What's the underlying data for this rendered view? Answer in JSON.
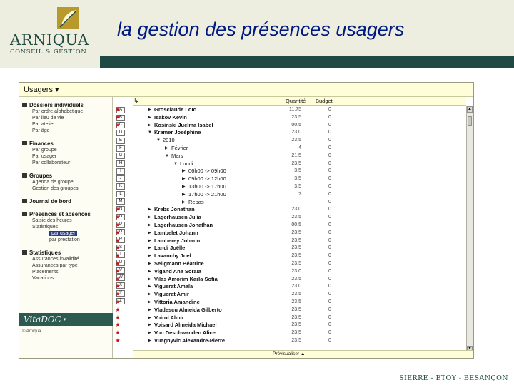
{
  "logo": {
    "name": "ARNIQUA",
    "subtitle": "CONSEIL & GESTION"
  },
  "slide": {
    "title": "la gestion des présences usagers",
    "footer": "SIERRE - ETOY - BESANÇON"
  },
  "colors": {
    "title": "#001a80",
    "brand": "#1f4a44",
    "header_bg": "#eeeee0",
    "star": "#c01010",
    "selection": "#2a3a8a"
  },
  "app": {
    "sidebar_title": "Usagers ▾",
    "sections": [
      {
        "label": "Dossiers individuels",
        "items": [
          "Par ordre alphabétique",
          "Par lieu de vie",
          "Par atelier",
          "Par âge"
        ]
      },
      {
        "label": "Finances",
        "items": [
          "Par groupe",
          "Par usager",
          "Par collaborateur"
        ]
      },
      {
        "label": "Groupes",
        "items": [
          "Agenda de groupe",
          "Gestion des groupes"
        ]
      },
      {
        "label": "Journal de bord",
        "items": []
      },
      {
        "label": "Présences et absences",
        "items": [
          "Saisie des heures",
          "Statistiques"
        ],
        "subitems": [
          "par usager",
          "par prestation"
        ]
      },
      {
        "label": "Statistiques",
        "items": [
          "Assurances invalidité",
          "Assurances par type",
          "Placements",
          "Vacations"
        ]
      }
    ],
    "vitadoc": {
      "label": "VitaDOC",
      "caret": "▾"
    },
    "copyright": "© Arniqua",
    "alphabet": [
      "A",
      "B",
      "C",
      "D",
      "E",
      "F",
      "G",
      "H",
      "I",
      "J",
      "K",
      "L",
      "M",
      "N",
      "O",
      "P",
      "Q",
      "R",
      "S",
      "T",
      "U",
      "V",
      "W",
      "X",
      "Y",
      "Z"
    ],
    "grid_header": {
      "icon": "↳",
      "quantite": "Quantité",
      "budget": "Budget"
    },
    "rows": [
      {
        "indent": 0,
        "arrow": "▶",
        "name": "Grosclaude Loïc",
        "qty": "11.75",
        "budget": "0"
      },
      {
        "indent": 0,
        "arrow": "▶",
        "name": "Isakov Kevin",
        "qty": "23.5",
        "budget": "0"
      },
      {
        "indent": 0,
        "arrow": "▶",
        "name": "Kosinski Juelma Isabel",
        "qty": "00.5",
        "budget": "0"
      },
      {
        "indent": 0,
        "arrow": "▼",
        "name": "Kramer Joséphine",
        "qty": "23.0",
        "budget": "0"
      },
      {
        "indent": 1,
        "arrow": "▼",
        "name": "2010",
        "qty": "23.5",
        "budget": "0"
      },
      {
        "indent": 2,
        "arrow": "▶",
        "name": "Février",
        "qty": "4",
        "budget": "0"
      },
      {
        "indent": 2,
        "arrow": "▼",
        "name": "Mars",
        "qty": "21.5",
        "budget": "0"
      },
      {
        "indent": 3,
        "arrow": "▼",
        "name": "Lundi",
        "qty": "23.5",
        "budget": "0"
      },
      {
        "indent": 4,
        "arrow": "▶",
        "name": "06h00 -> 09h00",
        "qty": "3.5",
        "budget": "0"
      },
      {
        "indent": 4,
        "arrow": "▶",
        "name": "09h00 -> 12h00",
        "qty": "3.5",
        "budget": "0"
      },
      {
        "indent": 4,
        "arrow": "▶",
        "name": "13h00 -> 17h00",
        "qty": "3.5",
        "budget": "0"
      },
      {
        "indent": 4,
        "arrow": "▶",
        "name": "17h00 -> 21h00",
        "qty": "7",
        "budget": "0"
      },
      {
        "indent": 4,
        "arrow": "▶",
        "name": "Repas",
        "qty": "",
        "budget": "0"
      },
      {
        "indent": 0,
        "arrow": "▶",
        "name": "Krebs Jonathan",
        "qty": "23.0",
        "budget": "0"
      },
      {
        "indent": 0,
        "arrow": "▶",
        "name": "Lagerhausen Julia",
        "qty": "23.5",
        "budget": "0"
      },
      {
        "indent": 0,
        "arrow": "▶",
        "name": "Lagerhausen Jonathan",
        "qty": "00.5",
        "budget": "0"
      },
      {
        "indent": 0,
        "arrow": "▶",
        "name": "Lambelet Johann",
        "qty": "23.5",
        "budget": "0"
      },
      {
        "indent": 0,
        "arrow": "▶",
        "name": "Lamberey Johann",
        "qty": "23.5",
        "budget": "0"
      },
      {
        "indent": 0,
        "arrow": "▶",
        "name": "Landi Joëlle",
        "qty": "23.5",
        "budget": "0"
      },
      {
        "indent": 0,
        "arrow": "▶",
        "name": "Lavanchy Joel",
        "qty": "23.5",
        "budget": "0"
      },
      {
        "indent": 0,
        "arrow": "▶",
        "name": "Seligmann Béatrice",
        "qty": "23.5",
        "budget": "0"
      },
      {
        "indent": 0,
        "arrow": "▶",
        "name": "Vigand Ana Soraïa",
        "qty": "23.0",
        "budget": "0"
      },
      {
        "indent": 0,
        "arrow": "▶",
        "name": "Vilas Amorim Karla Sofia",
        "qty": "23.5",
        "budget": "0"
      },
      {
        "indent": 0,
        "arrow": "▶",
        "name": "Viguerat Amaïa",
        "qty": "23.0",
        "budget": "0"
      },
      {
        "indent": 0,
        "arrow": "▶",
        "name": "Viguerat Amir",
        "qty": "23.5",
        "budget": "0"
      },
      {
        "indent": 0,
        "arrow": "▶",
        "name": "Vittoria Amandine",
        "qty": "23.5",
        "budget": "0"
      },
      {
        "indent": 0,
        "arrow": "▶",
        "name": "Vladescu Almeida Gilberto",
        "qty": "23.5",
        "budget": "0"
      },
      {
        "indent": 0,
        "arrow": "▶",
        "name": "Voirol Almir",
        "qty": "23.5",
        "budget": "0"
      },
      {
        "indent": 0,
        "arrow": "▶",
        "name": "Voisard Almeida Michael",
        "qty": "23.5",
        "budget": "0"
      },
      {
        "indent": 0,
        "arrow": "▶",
        "name": "Von Deschwanden Alice",
        "qty": "23.5",
        "budget": "0"
      },
      {
        "indent": 0,
        "arrow": "▶",
        "name": "Vuagnyvic Alexandre-Pierre",
        "qty": "23.5",
        "budget": "0"
      }
    ],
    "footer_button": "Prévisualiser ▲"
  }
}
